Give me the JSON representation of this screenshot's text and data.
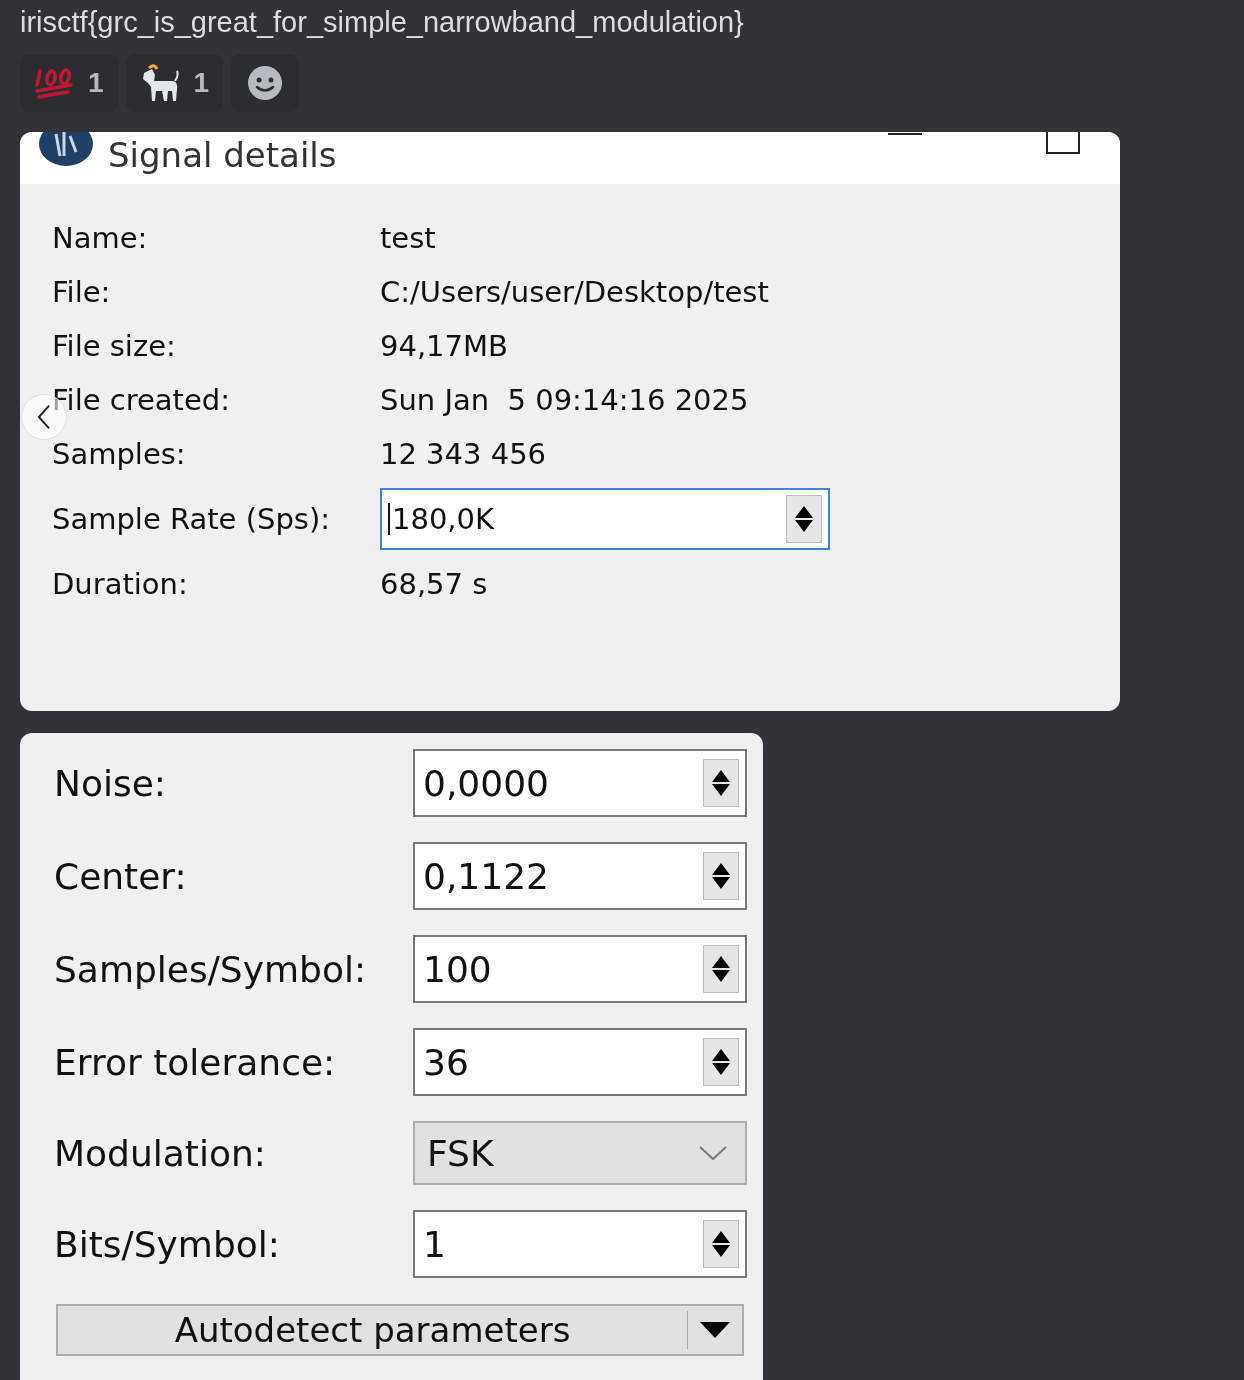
{
  "message": {
    "text": "irisctf{grc_is_great_for_simple_narrowband_modulation}"
  },
  "reactions": [
    {
      "kind": "hundred",
      "count": "1"
    },
    {
      "kind": "goat",
      "count": "1"
    },
    {
      "kind": "add"
    }
  ],
  "signal_details": {
    "title": "Signal details",
    "fields": [
      {
        "label": "Name:",
        "value": "test",
        "kind": "text"
      },
      {
        "label": "File:",
        "value": "C:/Users/user/Desktop/test",
        "kind": "text"
      },
      {
        "label": "File size:",
        "value": "94,17MB",
        "kind": "text"
      },
      {
        "label": "File created:",
        "value": "Sun Jan  5 09:14:16 2025",
        "kind": "text"
      },
      {
        "label": "Samples:",
        "value": "12 343 456",
        "kind": "text"
      },
      {
        "label": "Sample Rate (Sps):",
        "value": "180,0K",
        "kind": "spin"
      },
      {
        "label": "Duration:",
        "value": "68,57 s",
        "kind": "text"
      }
    ]
  },
  "parameters": {
    "fields": [
      {
        "label": "Noise:",
        "value": "0,0000",
        "kind": "spin"
      },
      {
        "label": "Center:",
        "value": "0,1122",
        "kind": "spin"
      },
      {
        "label": "Samples/Symbol:",
        "value": "100",
        "kind": "spin"
      },
      {
        "label": "Error tolerance:",
        "value": "36",
        "kind": "spin"
      },
      {
        "label": "Modulation:",
        "value": "FSK",
        "kind": "combo"
      },
      {
        "label": "Bits/Symbol:",
        "value": "1",
        "kind": "spin"
      }
    ],
    "button": "Autodetect parameters"
  }
}
